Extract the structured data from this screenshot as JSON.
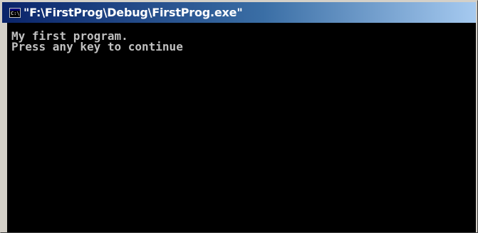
{
  "window": {
    "title": "\"F:\\FirstProg\\Debug\\FirstProg.exe\"",
    "icon": "console-window-icon",
    "icon_text": "C:\\"
  },
  "console": {
    "lines": [
      "My first program.",
      "Press any key to continue"
    ]
  },
  "colors": {
    "title_gradient_start": "#0a246a",
    "title_gradient_end": "#a6caf0",
    "console_background": "#000000",
    "console_text": "#c0c0c0"
  }
}
